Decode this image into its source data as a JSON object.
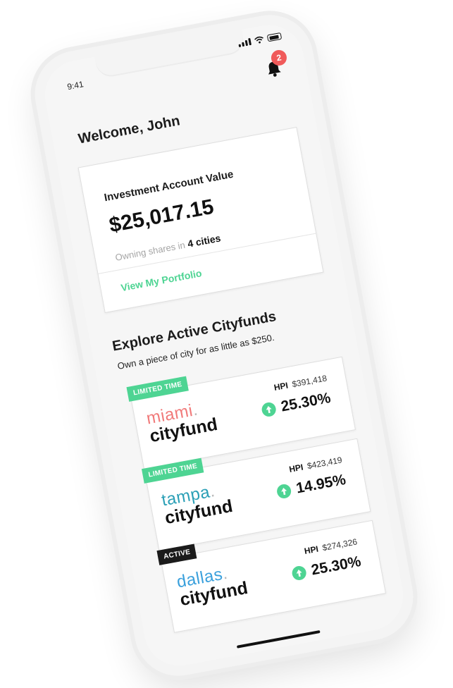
{
  "status_bar": {
    "time": "9:41"
  },
  "notifications": {
    "count": "2"
  },
  "welcome": "Welcome, John",
  "account": {
    "label": "Investment Account Value",
    "value": "$25,017.15",
    "owning_prefix": "Owning shares in",
    "owning_count": "4 cities",
    "link": "View My Portfolio"
  },
  "explore": {
    "title": "Explore Active Cityfunds",
    "subtitle": "Own a piece of city for as little as $250."
  },
  "colors": {
    "accent_green": "#4ed493",
    "badge_red": "#f05a5a",
    "miami": "#f17a7a",
    "tampa": "#2a9fb6",
    "dallas": "#3aa0dc",
    "active_tag": "#1b1b1b"
  },
  "funds": [
    {
      "tag": "LIMITED TIME",
      "tag_color": "#4ed493",
      "city": "miami",
      "dot": ".",
      "brand": "cityfund",
      "city_color": "#f17a7a",
      "hpi_label": "HPI",
      "hpi_value": "$391,418",
      "change": "25.30%"
    },
    {
      "tag": "LIMITED TIME",
      "tag_color": "#4ed493",
      "city": "tampa",
      "dot": ".",
      "brand": "cityfund",
      "city_color": "#2a9fb6",
      "hpi_label": "HPI",
      "hpi_value": "$423,419",
      "change": "14.95%"
    },
    {
      "tag": "ACTIVE",
      "tag_color": "#1b1b1b",
      "city": "dallas",
      "dot": ".",
      "brand": "cityfund",
      "city_color": "#3aa0dc",
      "hpi_label": "HPI",
      "hpi_value": "$274,326",
      "change": "25.30%"
    }
  ]
}
